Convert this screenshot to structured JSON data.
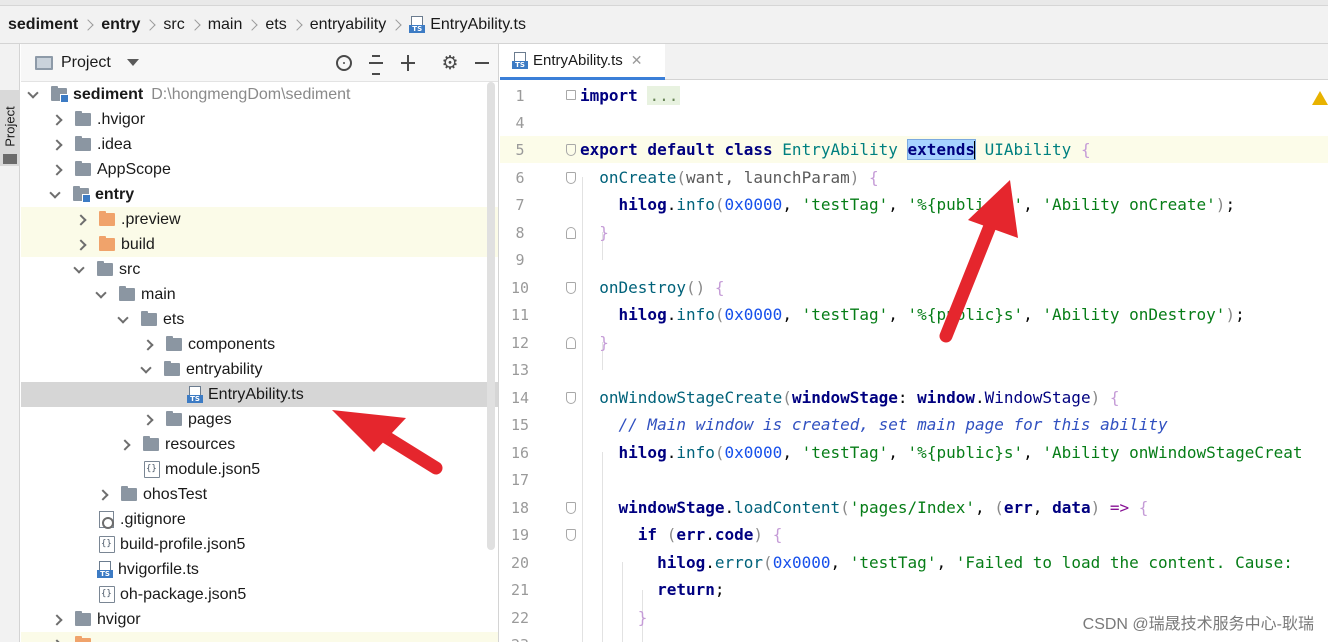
{
  "breadcrumb": {
    "items": [
      "sediment",
      "entry",
      "src",
      "main",
      "ets",
      "entryability",
      "EntryAbility.ts"
    ]
  },
  "toolstripe": {
    "label": "Project"
  },
  "project_panel": {
    "title": "Project",
    "icons": [
      "locate-icon",
      "expand-all-icon",
      "collapse-all-icon",
      "gear-icon",
      "hide-icon"
    ],
    "tree": [
      {
        "label": "sediment",
        "path": "D:\\hongmengDom\\sediment",
        "icon": "module-folder",
        "expanded": true
      },
      {
        "label": ".hvigor",
        "icon": "folder",
        "expanded": false
      },
      {
        "label": ".idea",
        "icon": "folder",
        "expanded": false
      },
      {
        "label": "AppScope",
        "icon": "folder",
        "expanded": false
      },
      {
        "label": "entry",
        "icon": "module-folder",
        "expanded": true
      },
      {
        "label": ".preview",
        "icon": "orange-folder",
        "expanded": false
      },
      {
        "label": "build",
        "icon": "orange-folder",
        "expanded": false
      },
      {
        "label": "src",
        "icon": "folder",
        "expanded": true
      },
      {
        "label": "main",
        "icon": "folder",
        "expanded": true
      },
      {
        "label": "ets",
        "icon": "folder",
        "expanded": true
      },
      {
        "label": "components",
        "icon": "folder",
        "expanded": false
      },
      {
        "label": "entryability",
        "icon": "folder",
        "expanded": true
      },
      {
        "label": "EntryAbility.ts",
        "icon": "ts-file",
        "selected": true
      },
      {
        "label": "pages",
        "icon": "folder",
        "expanded": false
      },
      {
        "label": "resources",
        "icon": "folder",
        "expanded": false
      },
      {
        "label": "module.json5",
        "icon": "json-file"
      },
      {
        "label": "ohosTest",
        "icon": "folder",
        "expanded": false
      },
      {
        "label": ".gitignore",
        "icon": "git-file"
      },
      {
        "label": "build-profile.json5",
        "icon": "json-file"
      },
      {
        "label": "hvigorfile.ts",
        "icon": "ts-file"
      },
      {
        "label": "oh-package.json5",
        "icon": "json-file"
      },
      {
        "label": "hvigor",
        "icon": "folder",
        "expanded": false
      }
    ]
  },
  "editor": {
    "tab_label": "EntryAbility.ts",
    "ts_badge": "TS",
    "lines": [
      {
        "n": "1",
        "text": "import ..."
      },
      {
        "n": "4",
        "text": ""
      },
      {
        "n": "5",
        "text": "export default class EntryAbility extends UIAbility {"
      },
      {
        "n": "6",
        "text": "onCreate(want, launchParam) {"
      },
      {
        "n": "7",
        "text": "hilog.info(0x0000, 'testTag', '%{public}s', 'Ability onCreate');"
      },
      {
        "n": "8",
        "text": "}"
      },
      {
        "n": "9",
        "text": ""
      },
      {
        "n": "10",
        "text": "onDestroy() {"
      },
      {
        "n": "11",
        "text": "hilog.info(0x0000, 'testTag', '%{public}s', 'Ability onDestroy');"
      },
      {
        "n": "12",
        "text": "}"
      },
      {
        "n": "13",
        "text": ""
      },
      {
        "n": "14",
        "text": "onWindowStageCreate(windowStage: window.WindowStage) {"
      },
      {
        "n": "15",
        "text": "// Main window is created, set main page for this ability"
      },
      {
        "n": "16",
        "text": "hilog.info(0x0000, 'testTag', '%{public}s', 'Ability onWindowStageCreat"
      },
      {
        "n": "17",
        "text": ""
      },
      {
        "n": "18",
        "text": "windowStage.loadContent('pages/Index', (err, data) => {"
      },
      {
        "n": "19",
        "text": "if (err.code) {"
      },
      {
        "n": "20",
        "text": "hilog.error(0x0000, 'testTag', 'Failed to load the content. Cause:"
      },
      {
        "n": "21",
        "text": "return;"
      },
      {
        "n": "22",
        "text": "}"
      },
      {
        "n": "23",
        "text": ""
      }
    ]
  },
  "watermark": "CSDN @瑞晟技术服务中心-耿瑞",
  "colors": {
    "keyword": "#000080",
    "function": "#00627a",
    "string": "#067d17",
    "number": "#1750eb",
    "comment": "#8c8c8c",
    "selection": "#a6d2ff",
    "annotation_arrow": "#e5262d"
  }
}
